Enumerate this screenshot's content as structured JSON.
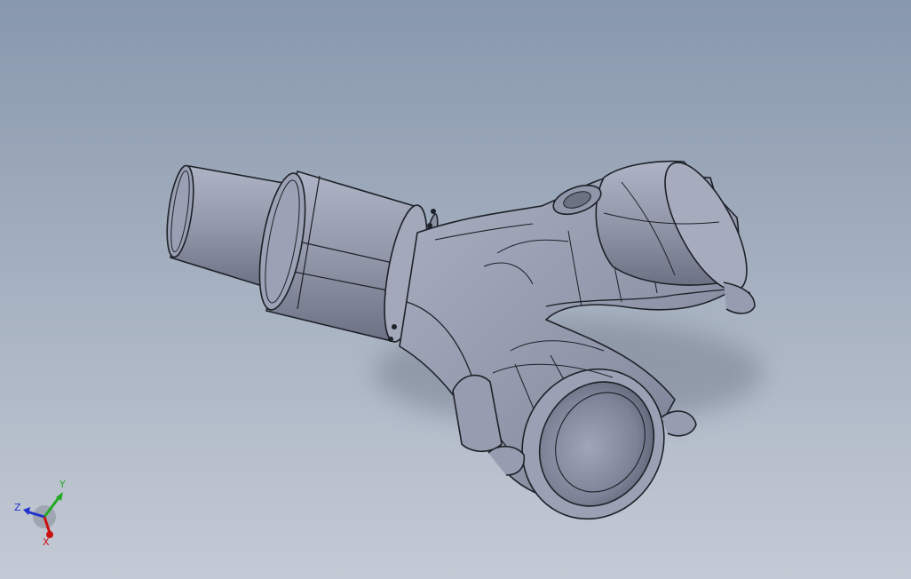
{
  "viewport": {
    "background_top": "#8898ad",
    "background_bottom": "#c4cad5",
    "part_color": "#9aa1b4",
    "edge_color": "#1e2128"
  },
  "triad": {
    "x_label": "X",
    "y_label": "Y",
    "z_label": "Z",
    "x_color": "#cc1111",
    "y_color": "#22aa22",
    "z_color": "#2233cc"
  }
}
